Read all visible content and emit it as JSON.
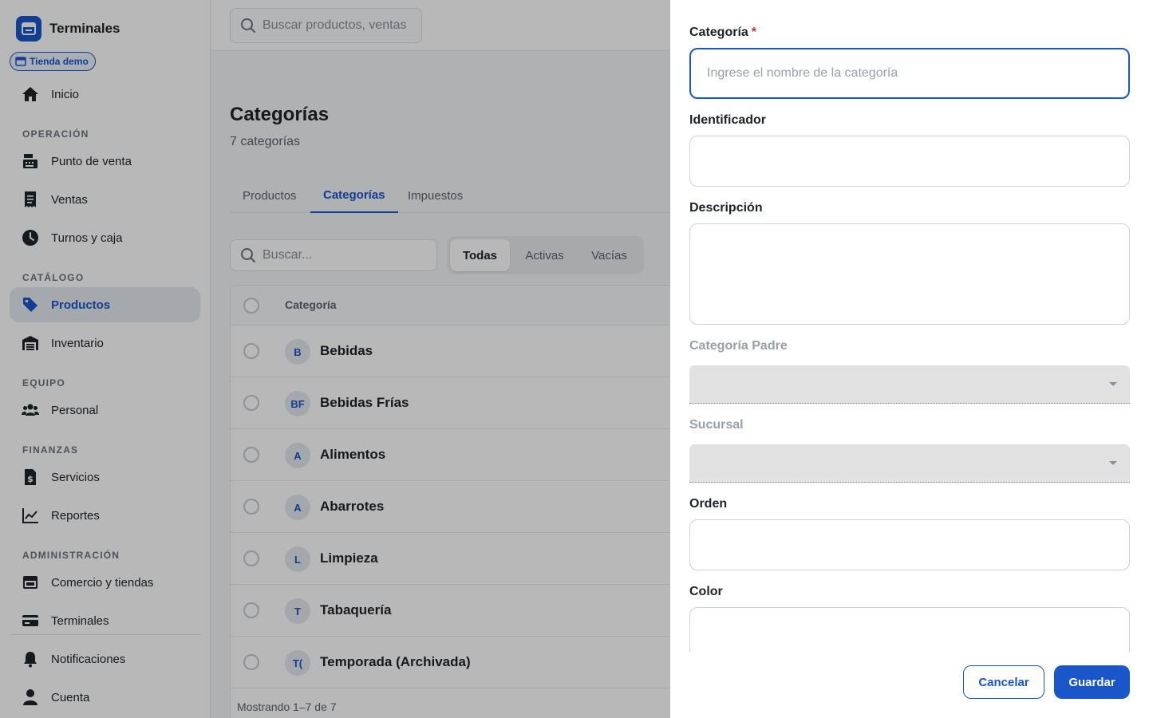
{
  "brand": {
    "name": "Terminales",
    "store": "Tienda demo"
  },
  "topbar": {
    "search_placeholder": "Buscar productos, ventas"
  },
  "sidebar": {
    "home": "Inicio",
    "sections": {
      "operacion": "OPERACIÓN",
      "catalogo": "CATÁLOGO",
      "equipo": "EQUIPO",
      "finanzas": "FINANZAS",
      "administracion": "ADMINISTRACIÓN"
    },
    "items": {
      "punto_venta": "Punto de venta",
      "ventas": "Ventas",
      "turnos": "Turnos y caja",
      "productos": "Productos",
      "inventario": "Inventario",
      "personal": "Personal",
      "servicios": "Servicios",
      "reportes": "Reportes",
      "comercio": "Comercio y tiendas",
      "terminales": "Terminales",
      "notificaciones": "Notificaciones",
      "cuenta": "Cuenta"
    }
  },
  "main": {
    "title": "Categorías",
    "subtitle": "7 categorías",
    "tabs": [
      "Productos",
      "Categorías",
      "Impuestos"
    ],
    "active_tab": "Categorías",
    "search_placeholder": "Buscar...",
    "filters": [
      "Todas",
      "Activas",
      "Vacías"
    ],
    "table": {
      "header": "Categoría",
      "rows": [
        {
          "initials": "B",
          "name": "Bebidas"
        },
        {
          "initials": "BF",
          "name": "Bebidas Frías"
        },
        {
          "initials": "A",
          "name": "Alimentos"
        },
        {
          "initials": "A",
          "name": "Abarrotes"
        },
        {
          "initials": "L",
          "name": "Limpieza"
        },
        {
          "initials": "T",
          "name": "Tabaquería"
        },
        {
          "initials": "T(",
          "name": "Temporada (Archivada)"
        }
      ],
      "footer": "Mostrando 1–7 de 7"
    }
  },
  "drawer": {
    "fields": {
      "categoria": {
        "label": "Categoría",
        "required_mark": "*",
        "placeholder": "Ingrese el nombre de la categoría",
        "value": ""
      },
      "identificador": {
        "label": "Identificador",
        "value": ""
      },
      "descripcion": {
        "label": "Descripción",
        "value": ""
      },
      "categoria_padre": {
        "label": "Categoría Padre",
        "value": ""
      },
      "sucursal": {
        "label": "Sucursal",
        "value": ""
      },
      "orden": {
        "label": "Orden",
        "value": ""
      },
      "color": {
        "label": "Color",
        "value": ""
      }
    },
    "cancel": "Cancelar",
    "save": "Guardar"
  },
  "colors": {
    "accent": "#1856c9",
    "required": "#d92d2d",
    "overlay": "rgba(0,0,0,0.28)"
  }
}
